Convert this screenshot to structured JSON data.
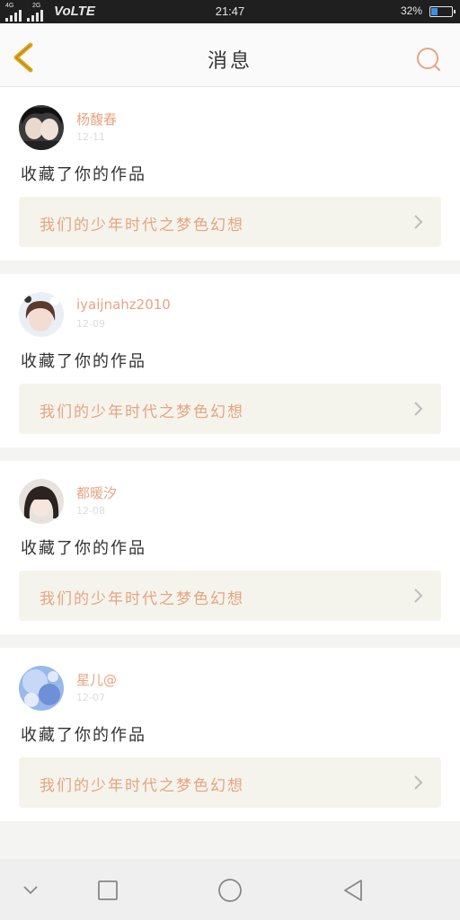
{
  "status_bar": {
    "net_left": "4G",
    "net_right": "2G",
    "carrier": "VoLTE",
    "time": "21:47",
    "battery_percent": "32%",
    "battery_level": 0.32
  },
  "header": {
    "title": "消息",
    "back_icon": "chevron-left-icon",
    "search_icon": "search-icon"
  },
  "messages": [
    {
      "name": "杨馥春",
      "date": "12-11",
      "action": "收藏了你的作品",
      "work_title": "我们的少年时代之梦色幻想"
    },
    {
      "name": "iyaijnahz2010",
      "date": "12-09",
      "action": "收藏了你的作品",
      "work_title": "我们的少年时代之梦色幻想"
    },
    {
      "name": "都暖汐",
      "date": "12-08",
      "action": "收藏了你的作品",
      "work_title": "我们的少年时代之梦色幻想"
    },
    {
      "name": "星儿@",
      "date": "12-07",
      "action": "收藏了你的作品",
      "work_title": "我们的少年时代之梦色幻想"
    }
  ],
  "colors": {
    "accent": "#e8a482",
    "back_arrow": "#e0a820",
    "card_bg": "#f4f4ec"
  }
}
